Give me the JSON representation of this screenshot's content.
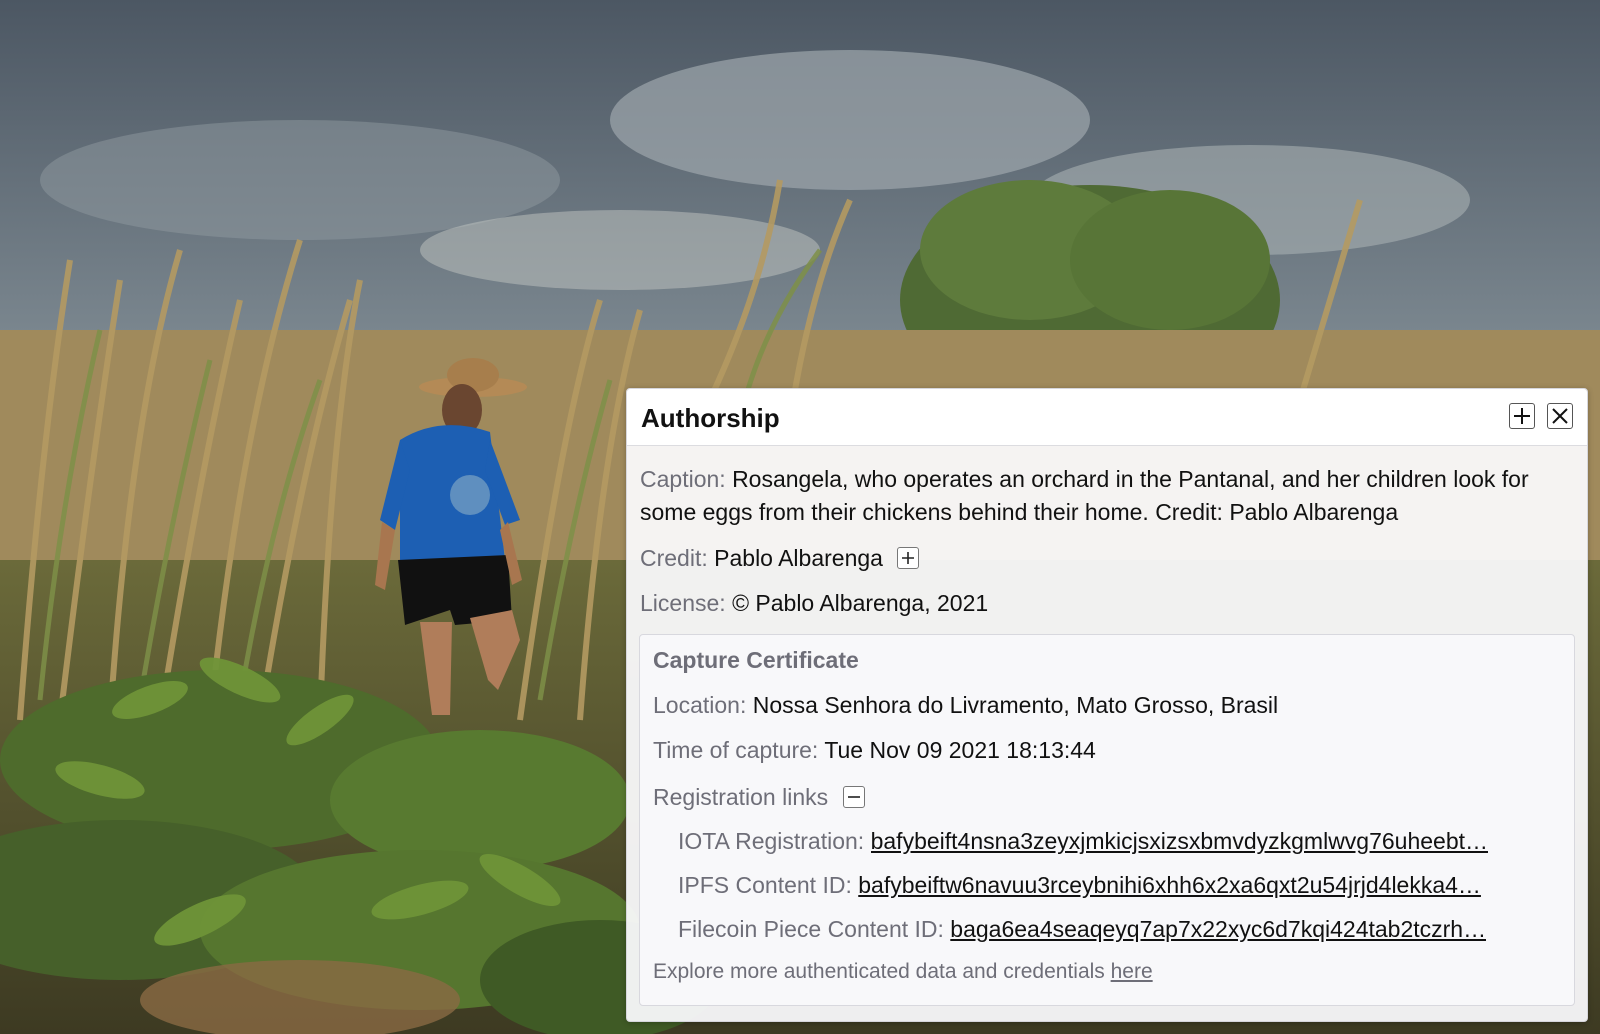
{
  "panel": {
    "title": "Authorship",
    "expand_icon": "plus-icon",
    "close_icon": "close-icon"
  },
  "caption": {
    "label": "Caption:",
    "value": "Rosangela, who operates an orchard in the Pantanal, and her children look for some eggs from their chickens behind their home. Credit: Pablo Albarenga"
  },
  "credit": {
    "label": "Credit:",
    "value": "Pablo Albarenga",
    "expand_icon": "plus-icon"
  },
  "license": {
    "label": "License:",
    "value": "© Pablo Albarenga, 2021"
  },
  "certificate": {
    "title": "Capture Certificate",
    "location_label": "Location:",
    "location_value": "Nossa Senhora do Livramento, Mato Grosso, Brasil",
    "time_label": "Time of capture:",
    "time_value": "Tue Nov 09 2021 18:13:44",
    "registration_label": "Registration links",
    "collapse_icon": "minus-icon",
    "links": [
      {
        "label": "IOTA Registration:",
        "value": "bafybeift4nsna3zeyxjmkicjsxizsxbmvdyzkgmlwvg76uheebt…"
      },
      {
        "label": "IPFS Content ID:",
        "value": "bafybeiftw6navuu3rceybnihi6xhh6x2xa6qxt2u54jrjd4lekka4…"
      },
      {
        "label": "Filecoin Piece Content ID:",
        "value": "baga6ea4seaqeyq7ap7x22xyc6d7kqi424tab2tczrh…"
      }
    ],
    "footer_text": "Explore more authenticated data and credentials ",
    "footer_link": "here"
  }
}
